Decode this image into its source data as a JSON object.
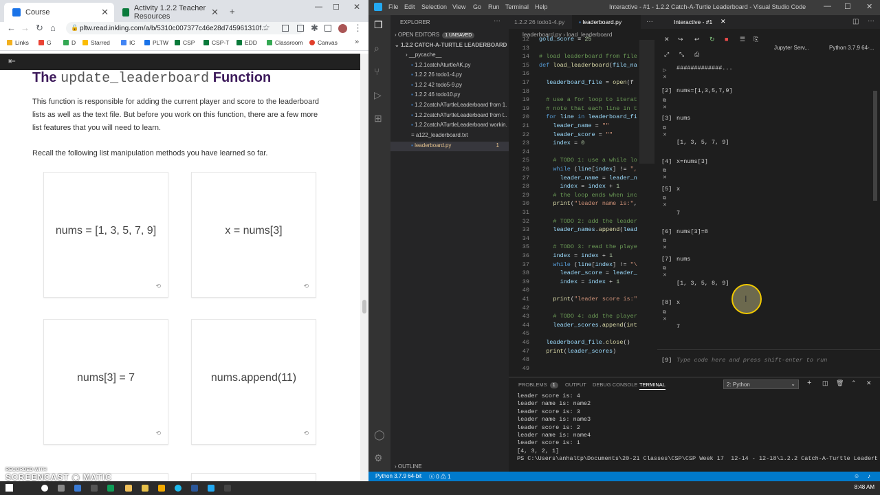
{
  "chrome": {
    "tabs": [
      {
        "label": "Course",
        "color": "#1a73e8"
      },
      {
        "label": "Activity 1.2.2 Teacher Resources",
        "color": "#0a7a3b"
      }
    ],
    "url": "pltw.read.inkling.com/a/b/5310c007377c46e28d745961310f...",
    "bookmarks": [
      "Links",
      "G",
      "D",
      "Starred",
      "IC",
      "PLTW",
      "CSP",
      "CSP-T",
      "EDD",
      "Classroom",
      "Canvas"
    ]
  },
  "page": {
    "heading_code": "update_leaderboard",
    "heading_pre": "The",
    "heading_post": "Function",
    "para1": "This function is responsible for adding the current player and score to the leaderboard lists as well as the text file. But before you work on this function, there are a few more list features that you will need to learn.",
    "para2": "Recall the following list manipulation methods you have learned so far.",
    "cards": [
      "nums = [1, 3, 5, 7, 9]",
      "x = nums[3]",
      "nums[3] = 7",
      "nums.append(11)"
    ]
  },
  "vscode": {
    "menus": [
      "File",
      "Edit",
      "Selection",
      "View",
      "Go",
      "Run",
      "Terminal",
      "Help"
    ],
    "title": "Interactive - #1 - 1.2.2 Catch-A-Turtle Leaderboard - Visual Studio Code",
    "explorer_title": "EXPLORER",
    "open_editors": "OPEN EDITORS",
    "unsaved": "1 UNSAVED",
    "folder": "1.2.2 CATCH-A-TURTLE LEADERBOARD",
    "files": [
      "__pycache__",
      "1.2.1catchAturtleAK.py",
      "1.2.2 26 todo1-4.py",
      "1.2.2 42 todo5-9.py",
      "1.2.2 46 todo10.py",
      "1.2.2catchATurtleLeaderboard from 1...",
      "1.2.2catchATurtleLeaderboard from t...",
      "1.2.2catchATurtleLeaderboard workin...",
      "a122_leaderboard.txt",
      "leaderboard.py"
    ],
    "selected_badge": "1",
    "outline": "OUTLINE",
    "editor_tabs": [
      "1.2.2 26 todo1-4.py",
      "leaderboard.py"
    ],
    "crumbs": [
      "leaderboard.py",
      "load_leaderboard"
    ],
    "interactive_tab": "Interactive - #1",
    "jupyter": "Jupyter Serv...",
    "python": "Python 3.7.9 64-...",
    "cells": [
      {
        "no": "",
        "code": "#############..."
      },
      {
        "no": "[2]",
        "code": "nums=[1,3,5,7,9]"
      },
      {
        "no": "[3]",
        "code": "nums"
      },
      {
        "no": "",
        "code": "[1, 3, 5, 7, 9]"
      },
      {
        "no": "[4]",
        "code": "x=nums[3]"
      },
      {
        "no": "[5]",
        "code": "x"
      },
      {
        "no": "",
        "code": "7"
      },
      {
        "no": "[6]",
        "code": "nums[3]=8"
      },
      {
        "no": "[7]",
        "code": "nums"
      },
      {
        "no": "",
        "code": "[1, 3, 5, 8, 9]"
      },
      {
        "no": "[8]",
        "code": "x"
      },
      {
        "no": "",
        "code": "7"
      }
    ],
    "input_no": "[9]",
    "input_placeholder": "Type code here and press shift-enter to run",
    "panel_tabs": [
      "PROBLEMS",
      "OUTPUT",
      "DEBUG CONSOLE",
      "TERMINAL"
    ],
    "problems_count": "1",
    "terminal_select": "2: Python",
    "terminal_lines": [
      "leader score is: 4",
      "leader name is: name2",
      "leader score is: 3",
      "leader name is: name3",
      "leader score is: 2",
      "leader name is: name4",
      "leader score is: 1",
      "[4, 3, 2, 1]",
      "PS C:\\Users\\anhaltp\\Documents\\20-21 Classes\\CSP\\CSP Week 17  12-14 - 12-18\\1.2.2 Catch-A-Turtle Leaderboard> "
    ],
    "status_python": "Python 3.7.9 64-bit",
    "status_problems": "ⓧ 0 ⚠ 1"
  },
  "taskbar": {
    "time": "8:48 AM"
  },
  "watermark": {
    "top": "RECORDED WITH",
    "brand": "SCREENCAST",
    "brand2": "MATIC"
  }
}
